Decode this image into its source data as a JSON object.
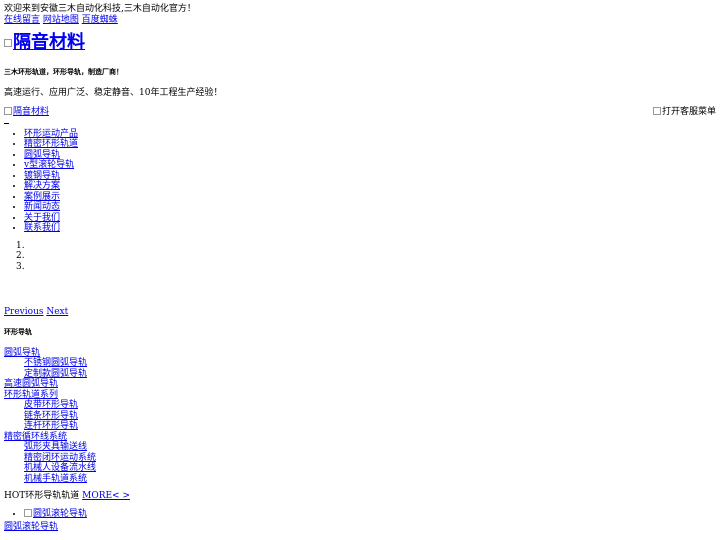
{
  "topbar": {
    "welcome": "欢迎来到安徽三木自动化科技,三木自动化官方！",
    "links": [
      "在线留言",
      "网站地图",
      "百度蜘蛛"
    ]
  },
  "header": {
    "logo_alt": "隔音材料",
    "slogan_bold": "三木环形轨道，环形导轨，制造厂商！",
    "slogan": "高速运行、应用广泛、稳定静音、10年工程生产经验！",
    "mobile_logo_alt": "隔音材料",
    "service_menu_alt": "打开客服菜单"
  },
  "nav": {
    "items": [
      "环形运动产品",
      "精密环形轨道",
      "圆弧导轨",
      "v型滚轮导轨",
      "镀钢导轨",
      "解决方案",
      "案例展示",
      "新闻动态",
      "关于我们",
      "联系我们"
    ]
  },
  "slider": {
    "indicators": [
      "1.",
      "2.",
      "3."
    ],
    "prev": "Previous",
    "next": "Next"
  },
  "sidebar": {
    "title": "环形导轨",
    "categories": [
      {
        "label": "圆弧导轨",
        "children": [
          "不锈钢圆弧导轨",
          "定制款圆弧导轨"
        ]
      },
      {
        "label": "高速圆弧导轨",
        "children": []
      },
      {
        "label": "环形轨道系列",
        "children": [
          "皮带环形导轨",
          "链条环形导轨",
          "连杆环形导轨"
        ]
      },
      {
        "label": "精密循环线系统",
        "children": [
          "弧形夹具输送线",
          "精密闭环运动系统",
          "机械人设备流水线",
          "机械手轨道系统"
        ]
      }
    ]
  },
  "hot": {
    "label": "HOT环形导轨轨道",
    "more": "MORE< >",
    "items": [
      {
        "img_alt": "圆弧滚轮导轨",
        "name": "圆弧滚轮导轨"
      }
    ]
  }
}
